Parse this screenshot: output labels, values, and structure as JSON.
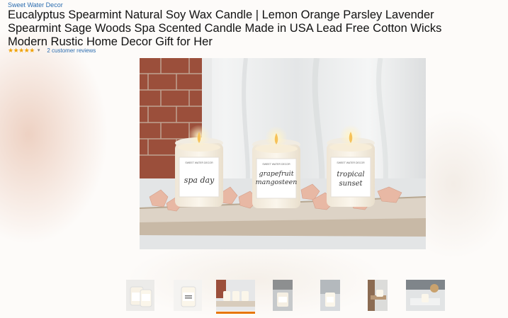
{
  "product": {
    "brand": "Sweet Water Decor",
    "title": "Eucalyptus Spearmint Natural Soy Wax Candle | Lemon Orange Parsley Lavender Spearmint Sage Woods Spa Scented Candle Made in USA Lead Free Cotton Wicks Modern Rustic Home Decor Gift for Her",
    "rating_stars": "★★★★★",
    "rating_value": 5,
    "reviews_link": "2 customer reviews"
  },
  "main_image": {
    "candles": [
      {
        "label_line1": "spa day",
        "label_line2": ""
      },
      {
        "label_line1": "grapefruit",
        "label_line2": "mangosteen"
      },
      {
        "label_line1": "tropical",
        "label_line2": "sunset"
      }
    ],
    "brand_small": "SWEET WATER DECOR"
  },
  "thumbnails": {
    "count": 7,
    "selected_index": 2,
    "accent_color": "#e77600"
  },
  "colors": {
    "link": "#2b6db0",
    "star": "#f0a100"
  }
}
